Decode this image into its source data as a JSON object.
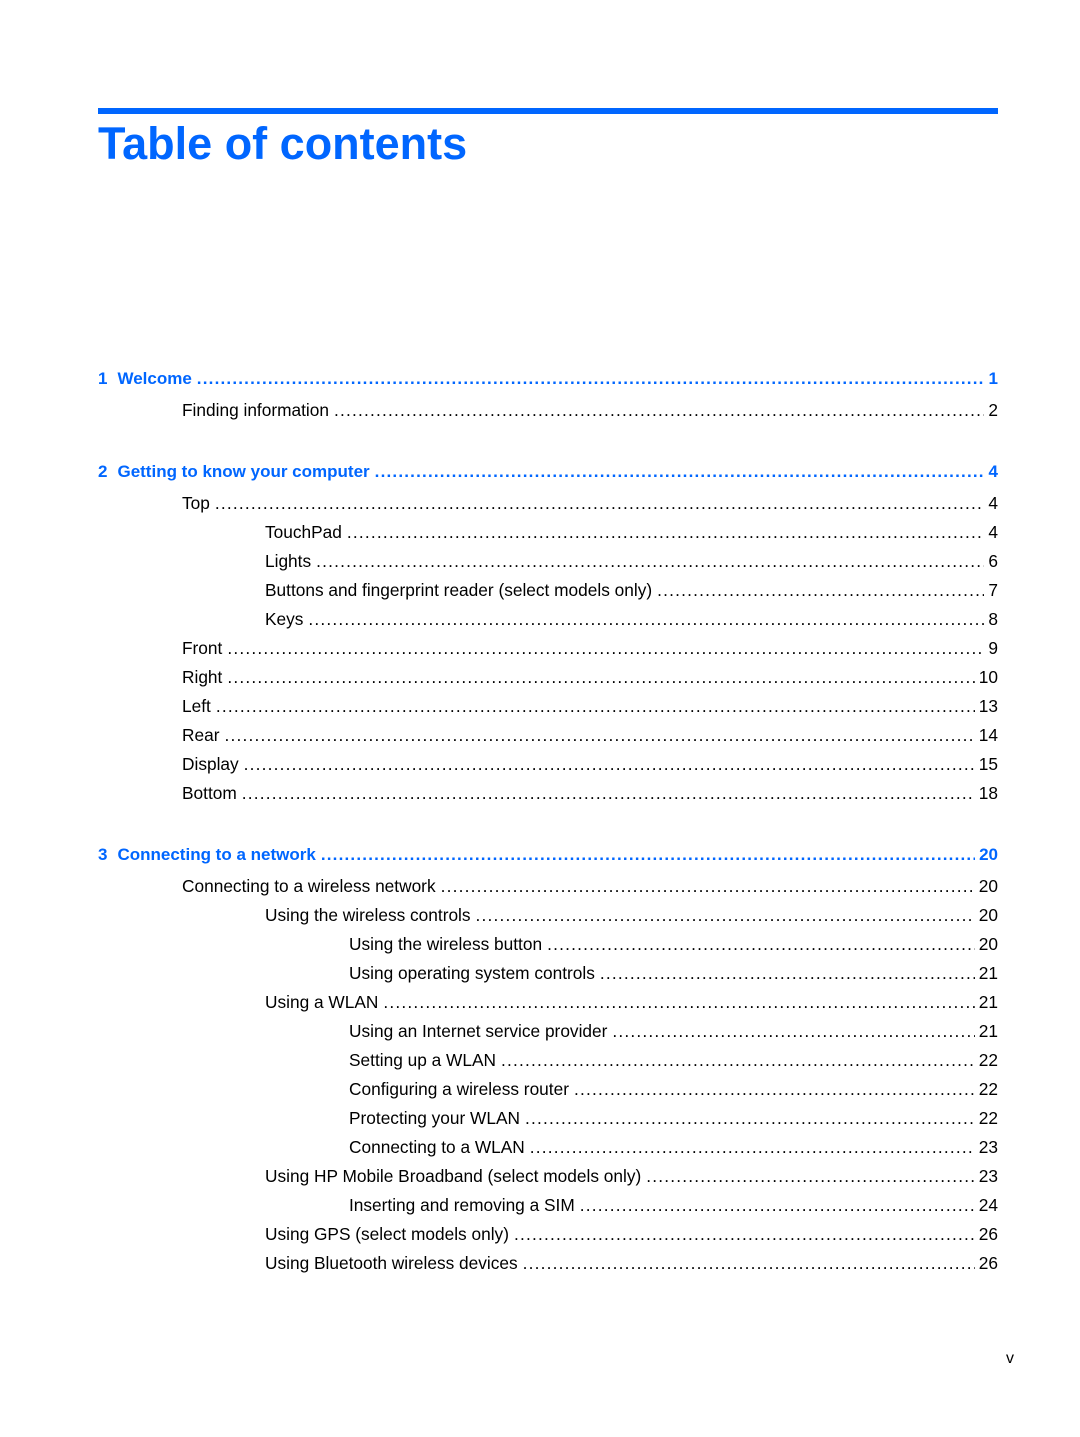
{
  "page": {
    "title": "Table of contents",
    "folio": "v",
    "accent_color": "#0066ff"
  },
  "toc": [
    {
      "level": 0,
      "number": "1",
      "label": "Welcome",
      "page": "1"
    },
    {
      "level": 1,
      "label": "Finding information",
      "page": "2"
    },
    {
      "level": 0,
      "number": "2",
      "label": "Getting to know your computer",
      "page": "4"
    },
    {
      "level": 1,
      "label": "Top",
      "page": "4"
    },
    {
      "level": 2,
      "label": "TouchPad",
      "page": "4"
    },
    {
      "level": 2,
      "label": "Lights",
      "page": "6"
    },
    {
      "level": 2,
      "label": "Buttons and fingerprint reader (select models only)",
      "page": "7"
    },
    {
      "level": 2,
      "label": "Keys",
      "page": "8"
    },
    {
      "level": 1,
      "label": "Front",
      "page": "9"
    },
    {
      "level": 1,
      "label": "Right",
      "page": "10"
    },
    {
      "level": 1,
      "label": "Left",
      "page": "13"
    },
    {
      "level": 1,
      "label": "Rear",
      "page": "14"
    },
    {
      "level": 1,
      "label": "Display",
      "page": "15"
    },
    {
      "level": 1,
      "label": "Bottom",
      "page": "18"
    },
    {
      "level": 0,
      "number": "3",
      "label": "Connecting to a network",
      "page": "20"
    },
    {
      "level": 1,
      "label": "Connecting to a wireless network",
      "page": "20"
    },
    {
      "level": 2,
      "label": "Using the wireless controls",
      "page": "20"
    },
    {
      "level": 3,
      "label": "Using the wireless button",
      "page": "20"
    },
    {
      "level": 3,
      "label": "Using operating system controls",
      "page": "21"
    },
    {
      "level": 2,
      "label": "Using a WLAN",
      "page": "21"
    },
    {
      "level": 3,
      "label": "Using an Internet service provider",
      "page": "21"
    },
    {
      "level": 3,
      "label": "Setting up a WLAN",
      "page": "22"
    },
    {
      "level": 3,
      "label": "Configuring a wireless router",
      "page": "22"
    },
    {
      "level": 3,
      "label": "Protecting your WLAN",
      "page": "22"
    },
    {
      "level": 3,
      "label": "Connecting to a WLAN",
      "page": "23"
    },
    {
      "level": 2,
      "label": "Using HP Mobile Broadband (select models only)",
      "page": "23"
    },
    {
      "level": 3,
      "label": "Inserting and removing a SIM",
      "page": "24"
    },
    {
      "level": 2,
      "label": "Using GPS (select models only)",
      "page": "26"
    },
    {
      "level": 2,
      "label": "Using Bluetooth wireless devices",
      "page": "26"
    }
  ]
}
